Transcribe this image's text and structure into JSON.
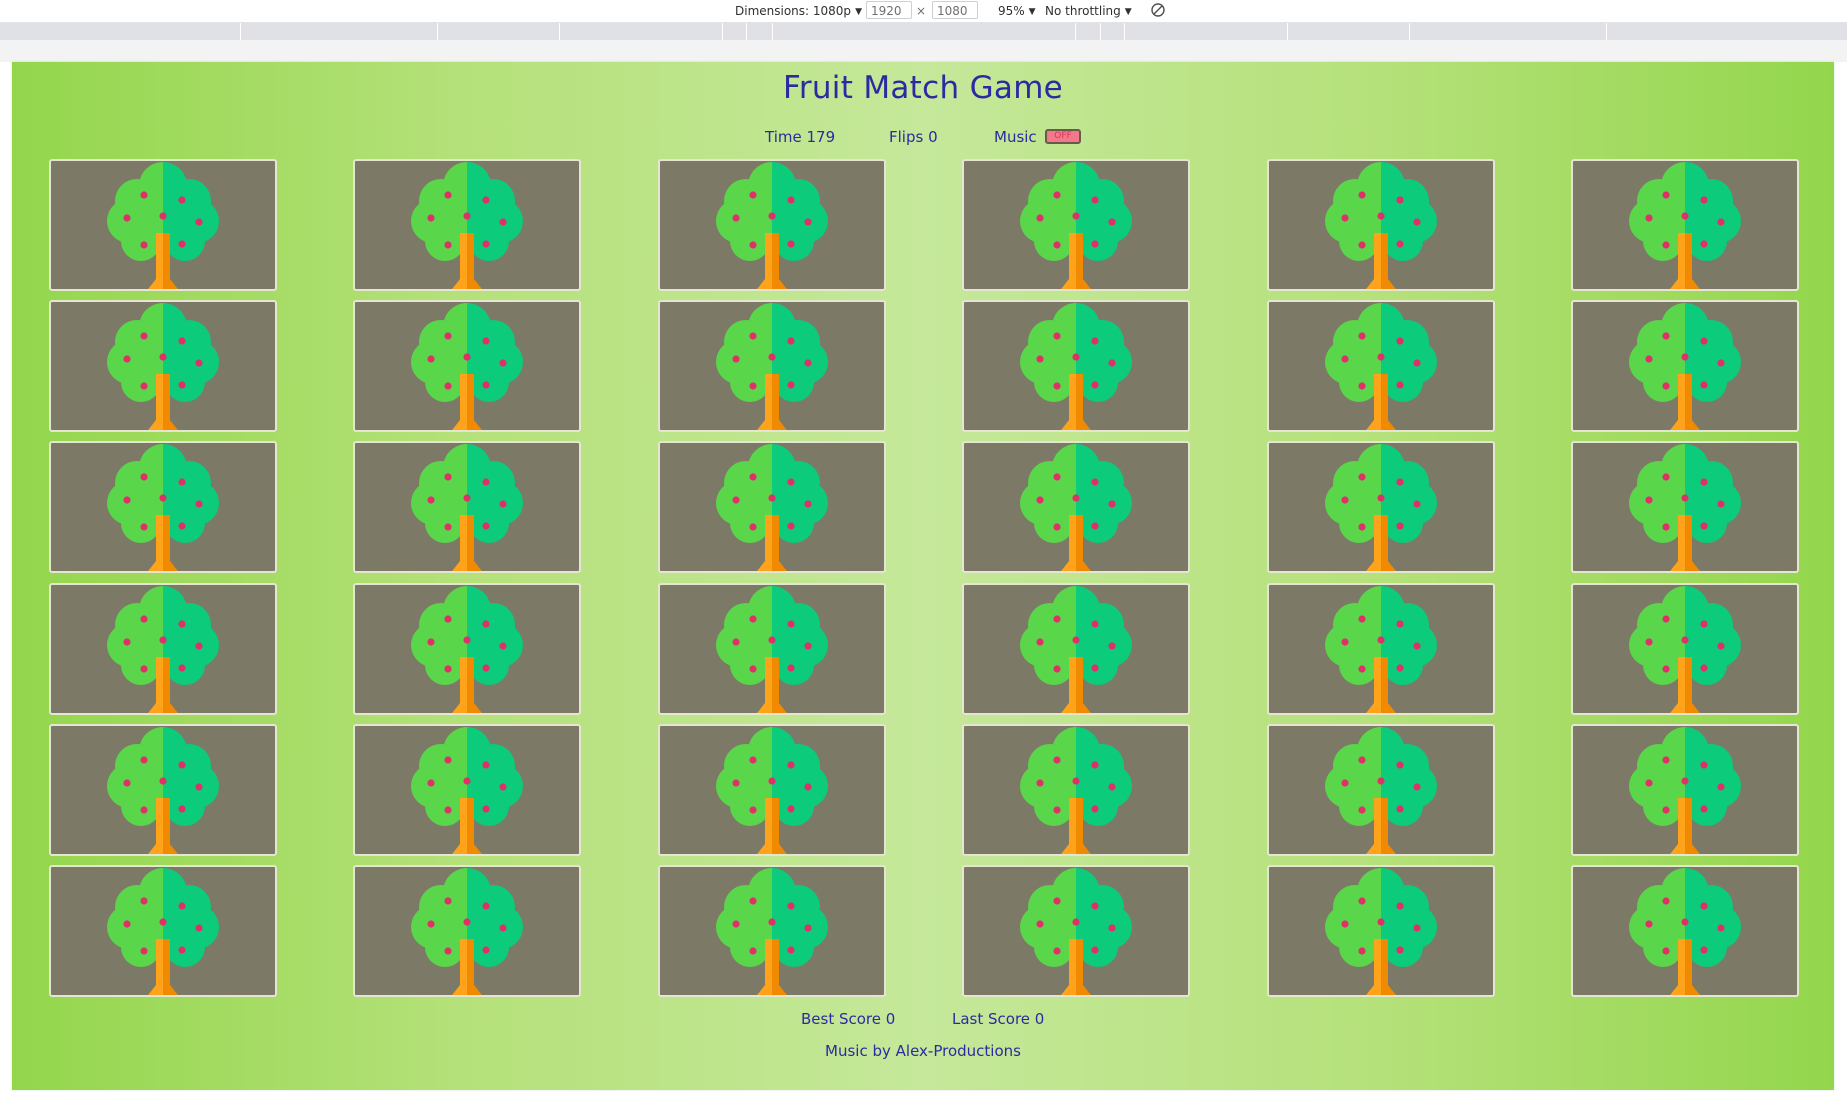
{
  "devtools": {
    "dimensions_label": "Dimensions: 1080p",
    "width_value": "1920",
    "times_sign": "×",
    "height_value": "1080",
    "zoom_label": "95%",
    "throttling_label": "No throttling",
    "rotate_icon": "rotate-icon"
  },
  "game": {
    "title": "Fruit Match Game",
    "time_label": "Time 179",
    "flips_label": "Flips 0",
    "music_label": "Music",
    "music_toggle": "OFF",
    "best_score_label": "Best Score 0",
    "last_score_label": "Last Score 0",
    "credit": "Music by Alex-Productions"
  },
  "board": {
    "rows": 6,
    "columns": 6,
    "card_face": "tree-icon",
    "colors": {
      "card_back": "#7c7a66",
      "card_border": "#e4e6d2",
      "canopy_light": "#5ad64a",
      "canopy_dark": "#0ccb7a",
      "trunk_light": "#ffa31a",
      "trunk_dark": "#f08a00",
      "fruit": "#e0306a"
    }
  },
  "theme": {
    "background_edge": "#93d64c",
    "background_center": "#c5e89a",
    "text": "#2d2aa0"
  }
}
